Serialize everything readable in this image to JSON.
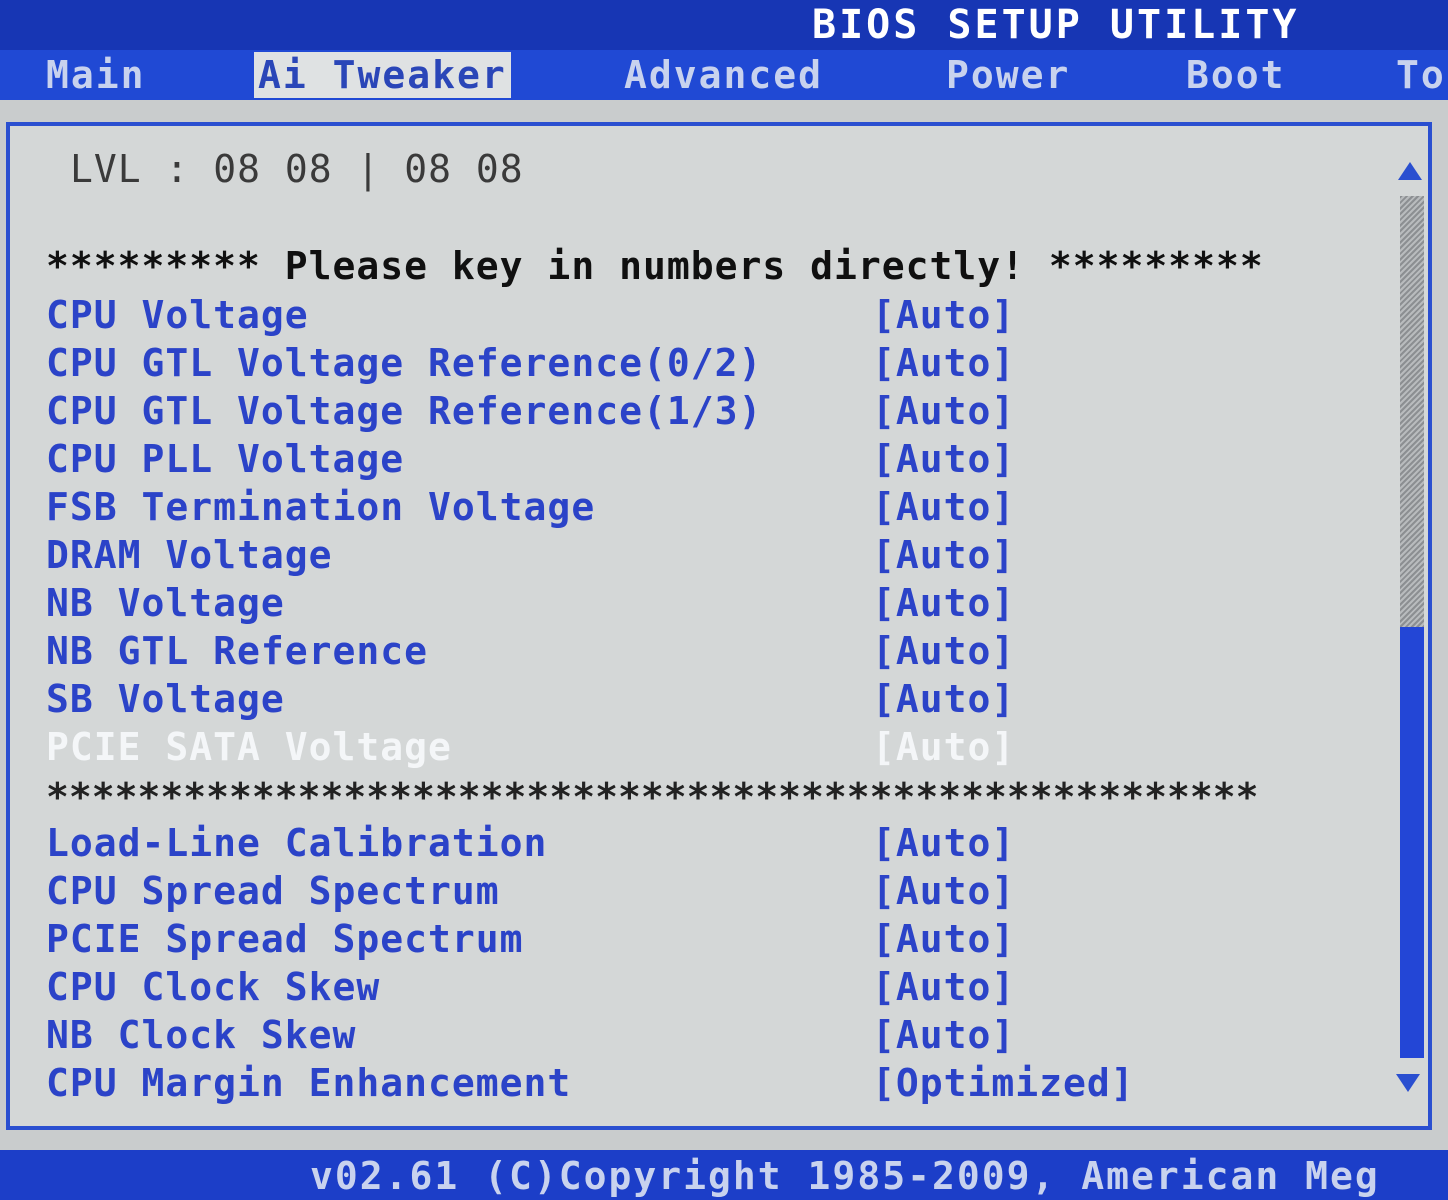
{
  "title": "BIOS SETUP UTILITY",
  "tabs": [
    "Main",
    "Ai Tweaker",
    "Advanced",
    "Power",
    "Boot",
    "To"
  ],
  "active_tab": "Ai Tweaker",
  "lvl_line": "LVL : 08 08 | 08 08",
  "notice": "********* Please key in numbers directly! *********",
  "voltage_items": [
    {
      "label": "CPU Voltage",
      "value": "[Auto]"
    },
    {
      "label": "CPU GTL Voltage Reference(0/2)",
      "value": "[Auto]"
    },
    {
      "label": "CPU GTL Voltage Reference(1/3)",
      "value": "[Auto]"
    },
    {
      "label": "CPU PLL Voltage",
      "value": "[Auto]"
    },
    {
      "label": "FSB Termination Voltage",
      "value": "[Auto]"
    },
    {
      "label": "DRAM Voltage",
      "value": "[Auto]"
    },
    {
      "label": "NB Voltage",
      "value": "[Auto]"
    },
    {
      "label": "NB GTL Reference",
      "value": "[Auto]"
    },
    {
      "label": "SB Voltage",
      "value": "[Auto]"
    },
    {
      "label": "PCIE SATA Voltage",
      "value": "[Auto]"
    }
  ],
  "selected_item": "PCIE SATA Voltage",
  "separator": "*****************************************************",
  "other_items": [
    {
      "label": "Load-Line Calibration",
      "value": "[Auto]"
    },
    {
      "label": "CPU Spread Spectrum",
      "value": "[Auto]"
    },
    {
      "label": "PCIE Spread Spectrum",
      "value": "[Auto]"
    },
    {
      "label": "CPU Clock Skew",
      "value": "[Auto]"
    },
    {
      "label": "NB Clock Skew",
      "value": "[Auto]"
    },
    {
      "label": "CPU Margin Enhancement",
      "value": "[Optimized]"
    }
  ],
  "scroll_position": 0.5,
  "footer": "v02.61 (C)Copyright 1985-2009, American Meg",
  "colors": {
    "background_blue": "#1f44cf",
    "panel_gray": "#d4d7d7",
    "item_blue": "#2b43c8",
    "selected_white": "#f4f6f8"
  }
}
